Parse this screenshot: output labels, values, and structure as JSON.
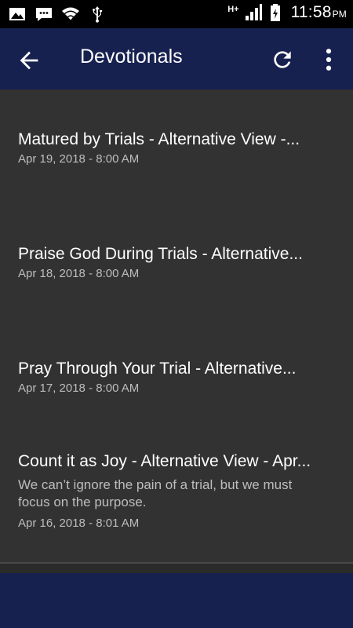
{
  "status_bar": {
    "time": "11:58",
    "ampm": "PM",
    "network": "H+",
    "icons": [
      "image-icon",
      "chat-icon",
      "wifi-icon",
      "usb-icon",
      "signal-icon",
      "battery-icon"
    ]
  },
  "app_bar": {
    "title": "Devotionals",
    "color": "#172150",
    "actions": [
      "back-arrow-icon",
      "refresh-icon",
      "more-vert-icon"
    ]
  },
  "devotionals": [
    {
      "title": "Matured by Trials - Alternative View -...",
      "date": "Apr 19, 2018 - 8:00 AM"
    },
    {
      "title": "Praise God During Trials - Alternative...",
      "date": "Apr 18, 2018 - 8:00 AM"
    },
    {
      "title": "Pray Through Your Trial - Alternative...",
      "date": "Apr 17, 2018 - 8:00 AM"
    },
    {
      "title": "Count it as Joy - Alternative View - Apr...",
      "summary": "We can’t ignore the pain of a trial, but we must focus on the purpose.",
      "date": "Apr 16, 2018 - 8:01 AM"
    }
  ]
}
